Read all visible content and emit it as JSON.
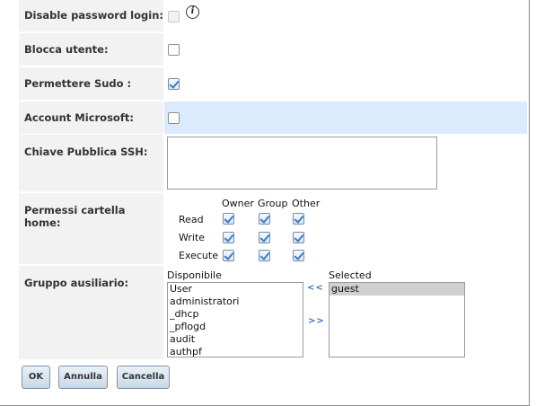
{
  "form": {
    "disable_password_login": {
      "label": "Disable password login:",
      "checked": false,
      "disabled": true,
      "info_icon": "info-icon"
    },
    "blocca_utente": {
      "label": "Blocca utente:",
      "checked": false
    },
    "permettere_sudo": {
      "label": "Permettere Sudo :",
      "checked": true
    },
    "account_microsoft": {
      "label": "Account Microsoft:",
      "checked": false
    },
    "chiave_ssh": {
      "label": "Chiave Pubblica SSH:",
      "value": ""
    },
    "permessi": {
      "label": "Permessi cartella home:",
      "columns": [
        "Owner",
        "Group",
        "Other"
      ],
      "rows": [
        {
          "label": "Read",
          "values": [
            true,
            true,
            true
          ]
        },
        {
          "label": "Write",
          "values": [
            true,
            true,
            true
          ]
        },
        {
          "label": "Execute",
          "values": [
            true,
            true,
            true
          ]
        }
      ]
    },
    "gruppo": {
      "label": "Gruppo ausiliario:",
      "available_label": "Disponibile",
      "available": [
        "User",
        "administratori",
        "_dhcp",
        "_pflogd",
        "audit",
        "authpf"
      ],
      "selected_label": "Selected",
      "selected": [
        "guest"
      ],
      "move_left": "<<",
      "move_right": ">>"
    }
  },
  "buttons": {
    "ok": "OK",
    "annulla": "Annulla",
    "cancella": "Cancella"
  },
  "colors": {
    "highlight_row": "#dbeafd",
    "label_bg": "#f2f2f2",
    "arrow": "#3b74c9",
    "button_border": "#7d95ad"
  }
}
